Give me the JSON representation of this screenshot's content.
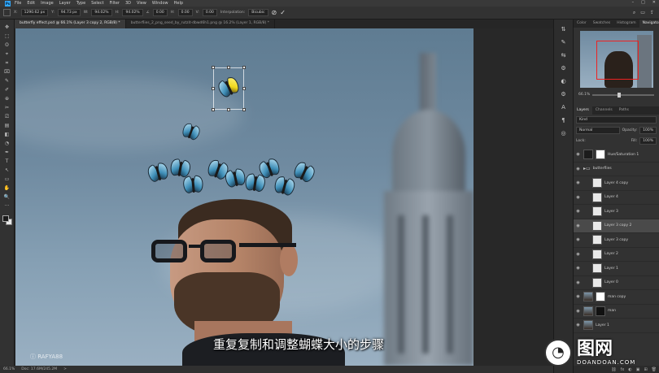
{
  "menubar": {
    "logo": "Ps",
    "items": [
      "File",
      "Edit",
      "Image",
      "Layer",
      "Type",
      "Select",
      "Filter",
      "3D",
      "View",
      "Window",
      "Help"
    ],
    "window_controls": [
      "–",
      "□",
      "✕"
    ]
  },
  "options": {
    "x_label": "X:",
    "x_value": "1290.62 px",
    "y_label": "Y:",
    "y_value": "94.73 px",
    "w_label": "W:",
    "w_value": "94.02%",
    "h_label": "H:",
    "h_value": "94.02%",
    "angle_label": "∠",
    "angle_value": "0.00",
    "h_skew_label": "H:",
    "h_skew_value": "0.00",
    "v_skew_label": "V:",
    "v_skew_value": "0.00",
    "interp_label": "Interpolation:",
    "interp_value": "Bicubic",
    "cancel_glyph": "⊘",
    "commit_glyph": "✓",
    "right_icons": [
      "⌕",
      "▭",
      "⇪"
    ]
  },
  "tabs": [
    {
      "label": "butterfly effect.psd @ 66.1% (Layer 3 copy 2, RGB/8) *",
      "active": true
    },
    {
      "label": "butterflies_2_png_seed_by_rutzit-dbwd6h1.png @ 16.2% (Layer 1, RGB/8) *",
      "active": false
    }
  ],
  "toolbar": {
    "tools": [
      "✥",
      "⬚",
      "ʘ",
      "⌖",
      "⌗",
      "⌧",
      "✎",
      "✐",
      "⊕",
      "✂",
      "⎚",
      "▤",
      "◧",
      "◔",
      "✒",
      "T",
      "↖",
      "▭",
      "✋",
      "🔍",
      "···"
    ]
  },
  "canvas": {
    "subtitle": "重复复制和调整蝴蝶大小的步骤",
    "watermark_user": "ⓘ RAFYA88"
  },
  "status": {
    "zoom": "66.1%",
    "doc": "Doc: 17.6M/245.2M",
    "arrow": ">"
  },
  "icon_strip": [
    "⇅",
    "✎",
    "⇆",
    "⚙",
    "◐",
    "⚙",
    "A",
    "¶",
    "◎"
  ],
  "panels": {
    "top_tabs": [
      {
        "label": "Color",
        "active": false
      },
      {
        "label": "Swatches",
        "active": false
      },
      {
        "label": "Histogram",
        "active": false
      },
      {
        "label": "Navigator",
        "active": true
      }
    ],
    "zoom": "66.1%",
    "layer_tabs": [
      {
        "label": "Layers",
        "active": true
      },
      {
        "label": "Channels",
        "active": false
      },
      {
        "label": "Paths",
        "active": false
      }
    ],
    "kind": "Kind",
    "blend": "Normal",
    "opacity_label": "Opacity:",
    "opacity": "100%",
    "lock_label": "Lock:",
    "fill_label": "Fill:",
    "fill": "100%",
    "layers": [
      {
        "name": "Hue/Saturation 1",
        "thumb": "adj",
        "active": false,
        "folder": false
      },
      {
        "name": "butterflies",
        "thumb": "none",
        "active": false,
        "folder": true
      },
      {
        "name": "Layer 4 copy",
        "thumb": "white",
        "active": false,
        "folder": false
      },
      {
        "name": "Layer 4",
        "thumb": "white",
        "active": false,
        "folder": false
      },
      {
        "name": "Layer 3",
        "thumb": "white",
        "active": false,
        "folder": false
      },
      {
        "name": "Layer 3 copy 2",
        "thumb": "white",
        "active": true,
        "folder": false
      },
      {
        "name": "Layer 3 copy",
        "thumb": "white",
        "active": false,
        "folder": false
      },
      {
        "name": "Layer 2",
        "thumb": "white",
        "active": false,
        "folder": false
      },
      {
        "name": "Layer 1",
        "thumb": "white",
        "active": false,
        "folder": false
      },
      {
        "name": "Layer 0",
        "thumb": "white",
        "active": false,
        "folder": false
      },
      {
        "name": "man copy",
        "thumb": "photo",
        "active": false,
        "folder": false
      },
      {
        "name": "man",
        "thumb": "photo",
        "active": false,
        "folder": false
      },
      {
        "name": "Layer 1",
        "thumb": "photo",
        "active": false,
        "folder": false
      }
    ],
    "footer_icons": [
      "⛓",
      "fx",
      "◐",
      "▣",
      "⊞",
      "🗑"
    ]
  },
  "site_watermark": {
    "logo": "◔",
    "cn": "图网",
    "en": "DOANDOAN.COM"
  }
}
